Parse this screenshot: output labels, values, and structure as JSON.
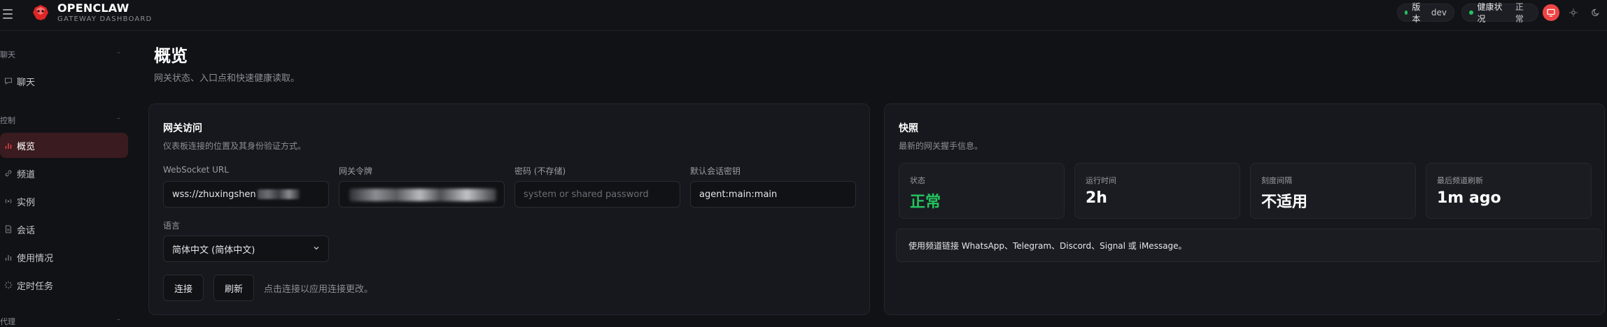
{
  "brand": {
    "title": "OPENCLAW",
    "subtitle": "GATEWAY DASHBOARD"
  },
  "header": {
    "version_label": "版本",
    "version_value": "dev",
    "health_label": "健康状况",
    "health_value": "正常",
    "status_color": "#22c55e",
    "accent": "#ef4444",
    "theme_icons": [
      "monitor-icon",
      "sun-icon",
      "moon-icon"
    ]
  },
  "sidebar": {
    "sections": [
      {
        "label": "聊天",
        "items": [
          {
            "label": "聊天",
            "icon": "chat-icon"
          }
        ]
      },
      {
        "label": "控制",
        "items": [
          {
            "label": "概览",
            "icon": "bar-chart-icon",
            "active": true
          },
          {
            "label": "频道",
            "icon": "link-icon"
          },
          {
            "label": "实例",
            "icon": "radio-icon"
          },
          {
            "label": "会话",
            "icon": "file-icon"
          },
          {
            "label": "使用情况",
            "icon": "bar-chart-icon"
          },
          {
            "label": "定时任务",
            "icon": "loader-icon"
          }
        ]
      },
      {
        "label": "代理",
        "items": []
      }
    ]
  },
  "page": {
    "title": "概览",
    "subtitle": "网关状态、入口点和快速健康读取。"
  },
  "gateway_access": {
    "title": "网关访问",
    "subtitle": "仪表板连接的位置及其身份验证方式。",
    "websocket_label": "WebSocket URL",
    "websocket_value": "wss://zhuxingshen",
    "token_label": "网关令牌",
    "password_label": "密码 (不存储)",
    "password_placeholder": "system or shared password",
    "session_key_label": "默认会话密钥",
    "session_key_value": "agent:main:main",
    "language_label": "语言",
    "language_value": "简体中文 (简体中文)",
    "connect_label": "连接",
    "refresh_label": "刷新",
    "hint": "点击连接以应用连接更改。"
  },
  "snapshot": {
    "title": "快照",
    "subtitle": "最新的网关握手信息。",
    "stats": [
      {
        "label": "状态",
        "value": "正常"
      },
      {
        "label": "运行时间",
        "value": "2h"
      },
      {
        "label": "刻度间隔",
        "value": "不适用"
      },
      {
        "label": "最后频道刷新",
        "value": "1m ago"
      }
    ],
    "note": "使用频道链接 WhatsApp、Telegram、Discord、Signal 或 iMessage。"
  }
}
